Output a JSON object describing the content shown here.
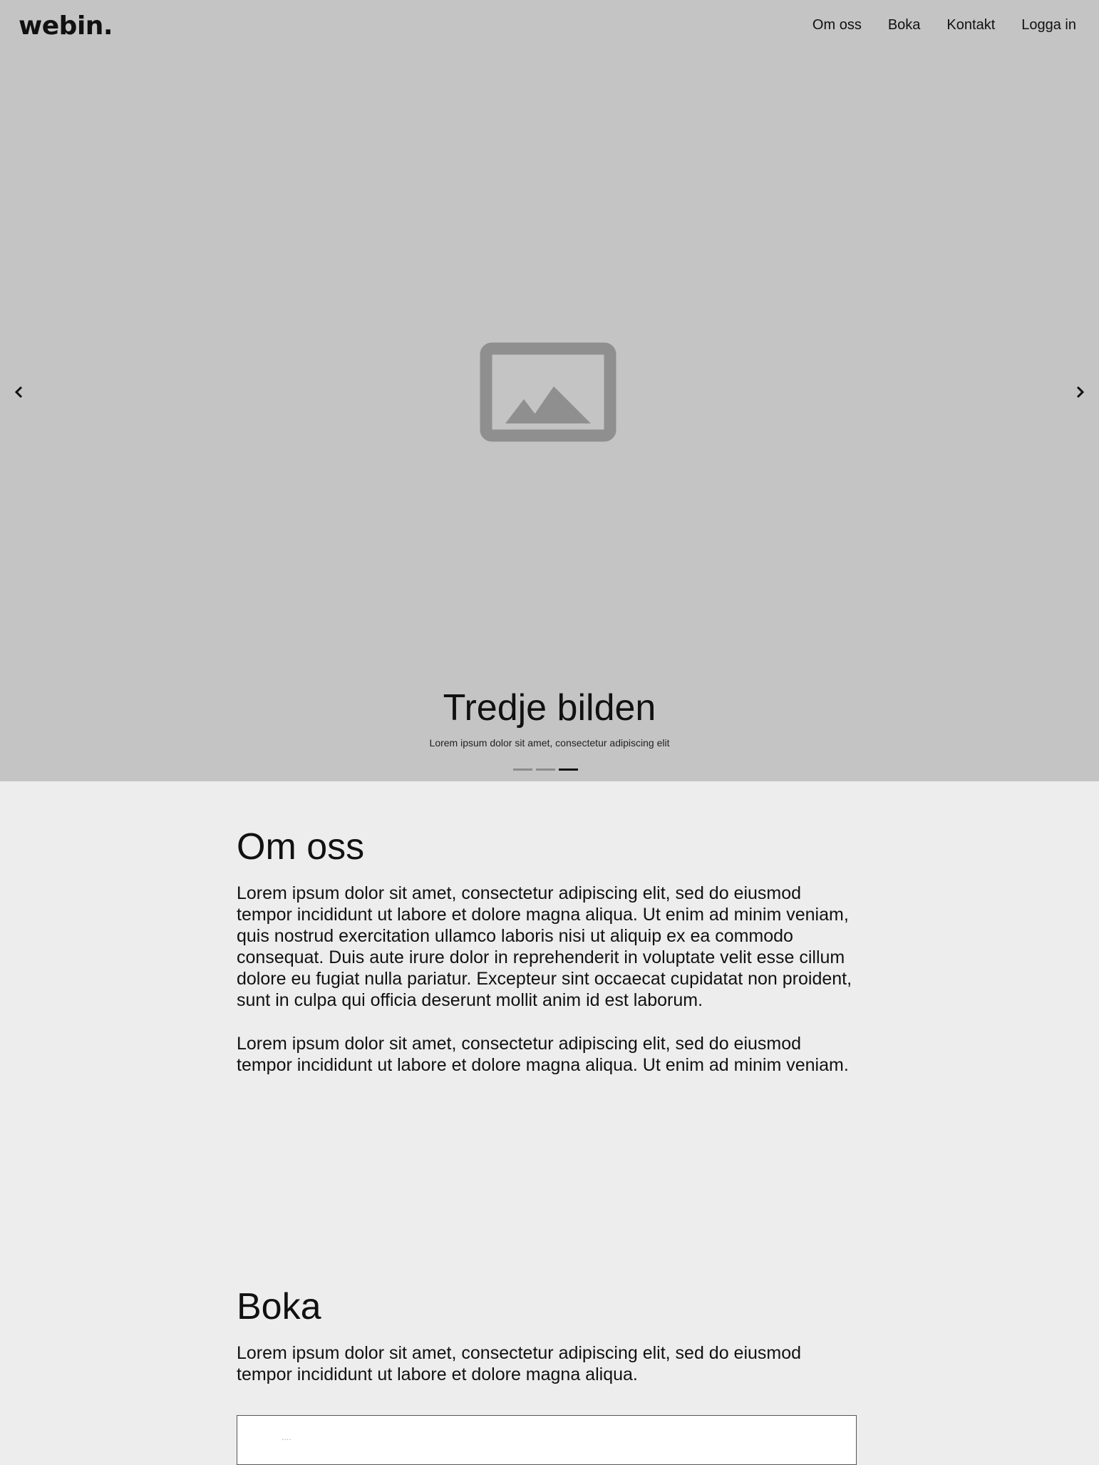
{
  "header": {
    "logo": "webin.",
    "nav": [
      {
        "label": "Om oss"
      },
      {
        "label": "Boka"
      },
      {
        "label": "Kontakt"
      },
      {
        "label": "Logga in"
      }
    ]
  },
  "carousel": {
    "slide_title": "Tredje bilden",
    "slide_subtitle": "Lorem ipsum dolor sit amet, consectetur adipiscing elit",
    "slide_count": 3,
    "active_slide": 3,
    "icons": {
      "previous": "chevron-left-icon",
      "next": "chevron-right-icon",
      "image": "image-placeholder-icon"
    }
  },
  "about": {
    "heading": "Om oss",
    "paragraphs": [
      "Lorem ipsum dolor sit amet, consectetur adipiscing elit, sed do eiusmod tempor incididunt ut labore et dolore magna aliqua. Ut enim ad minim veniam, quis nostrud exercitation ullamco laboris nisi ut aliquip ex ea commodo consequat. Duis aute irure dolor in reprehenderit in voluptate velit esse cillum dolore eu fugiat nulla pariatur. Excepteur sint occaecat cupidatat non proident, sunt in culpa qui officia deserunt mollit anim id est laborum.",
      "Lorem ipsum dolor sit amet, consectetur adipiscing elit, sed do eiusmod tempor incididunt ut labore et dolore magna aliqua. Ut enim ad minim veniam."
    ]
  },
  "booking": {
    "heading": "Boka",
    "text": "Lorem ipsum dolor sit amet, consectetur adipiscing elit, sed do eiusmod tempor incididunt ut labore et dolore magna aliqua.",
    "input_placeholder": "...."
  },
  "colors": {
    "hero_background": "#c4c4c4",
    "page_background": "#ededed",
    "text": "#111111",
    "indicator_inactive": "#8c8c8c",
    "indicator_active": "#111111"
  }
}
